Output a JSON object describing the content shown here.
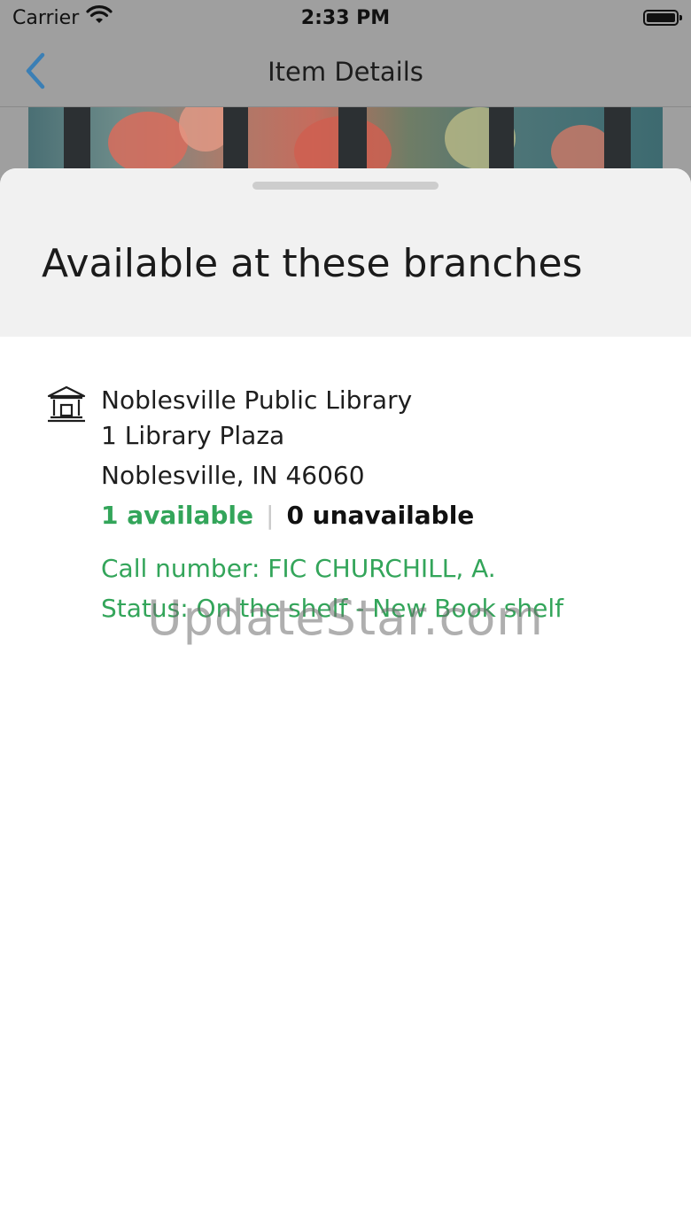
{
  "status_bar": {
    "carrier": "Carrier",
    "time": "2:33 PM",
    "wifi_icon": "wifi-icon",
    "battery_icon": "battery-icon"
  },
  "nav": {
    "title": "Item Details",
    "back_icon": "chevron-left-icon"
  },
  "sheet": {
    "title": "Available at these branches",
    "branches": [
      {
        "icon": "library-building-icon",
        "name": "Noblesville Public Library",
        "address_line1": "1 Library Plaza",
        "address_line2": "Noblesville, IN 46060",
        "available": "1 available",
        "separator": "|",
        "unavailable": "0 unavailable",
        "call_number": "Call number: FIC CHURCHILL, A.",
        "status": "Status: On the shelf - New Book shelf"
      }
    ]
  },
  "watermark": "UpdateStar.com",
  "colors": {
    "accent_green": "#33a55a",
    "back_blue": "#3b7fb5",
    "sheet_header_bg": "#f1f1f1"
  }
}
